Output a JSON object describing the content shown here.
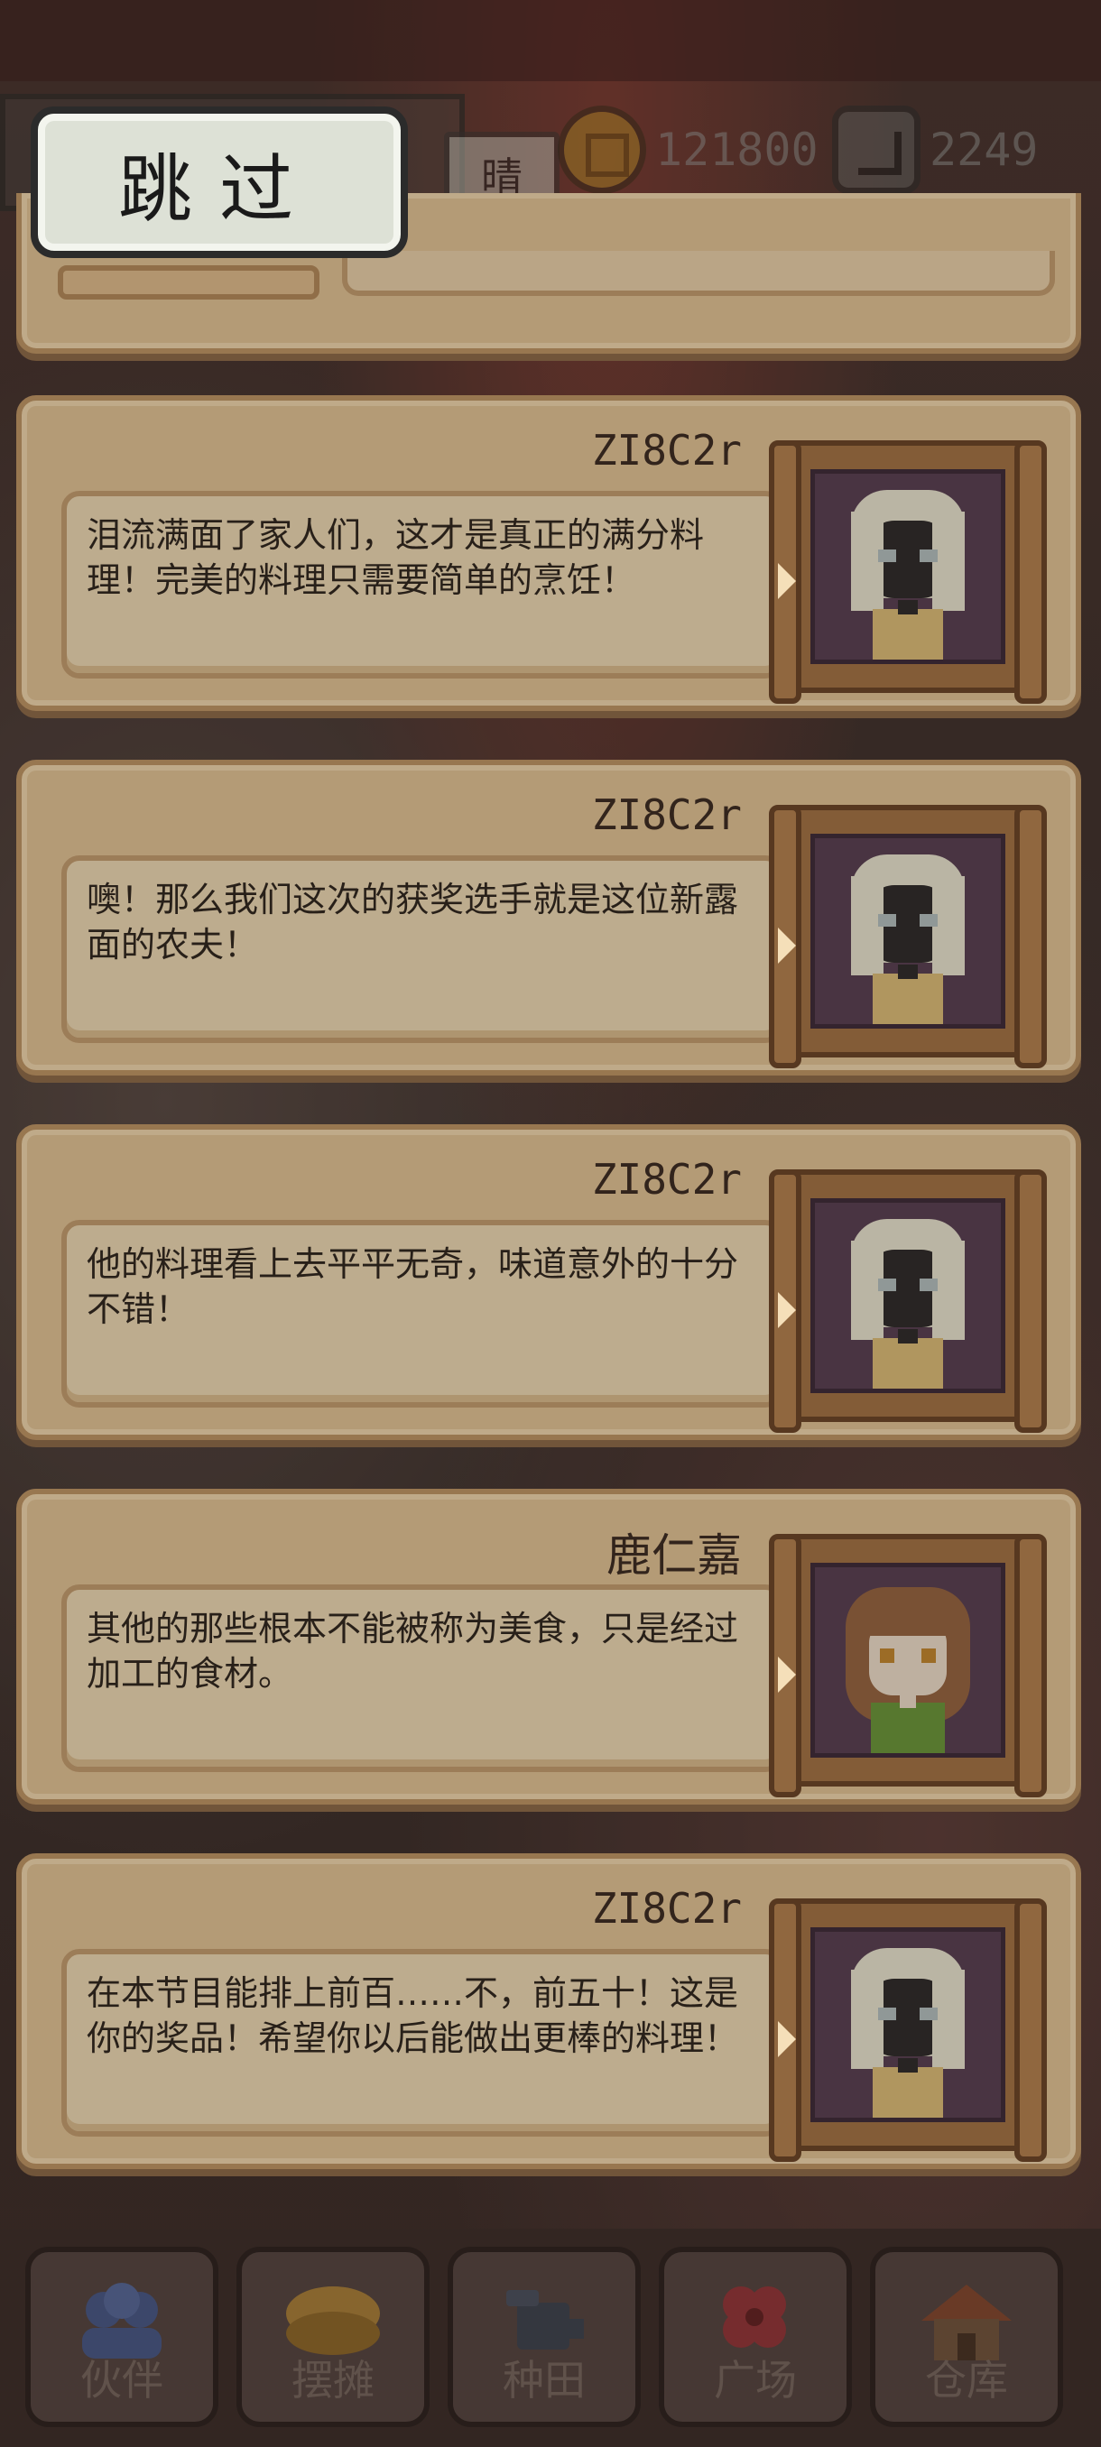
{
  "hud": {
    "skip_label": "跳过",
    "weather": "晴",
    "coins": "121800",
    "gems": "2249"
  },
  "dialogues": [
    {
      "speaker": "ZI8C2r",
      "text": "泪流满面了家人们，这才是真正的满分料理！完美的料理只需要简单的烹饪！",
      "portrait": "white-haired-girl"
    },
    {
      "speaker": "ZI8C2r",
      "text": "噢！那么我们这次的获奖选手就是这位新露面的农夫！",
      "portrait": "white-haired-girl"
    },
    {
      "speaker": "ZI8C2r",
      "text": "他的料理看上去平平无奇，味道意外的十分不错！",
      "portrait": "white-haired-girl"
    },
    {
      "speaker": "鹿仁嘉",
      "text": "其他的那些根本不能被称为美食，只是经过加工的食材。",
      "portrait": "brown-haired-girl"
    },
    {
      "speaker": "ZI8C2r",
      "text": "在本节目能排上前百……不，前五十！这是你的奖品！希望你以后能做出更棒的料理！",
      "portrait": "white-haired-girl"
    }
  ],
  "nav": [
    {
      "label": "伙伴",
      "icon": "partners-icon"
    },
    {
      "label": "摆摊",
      "icon": "stall-icon"
    },
    {
      "label": "种田",
      "icon": "farm-icon"
    },
    {
      "label": "广场",
      "icon": "plaza-icon"
    },
    {
      "label": "仓库",
      "icon": "warehouse-icon"
    }
  ]
}
